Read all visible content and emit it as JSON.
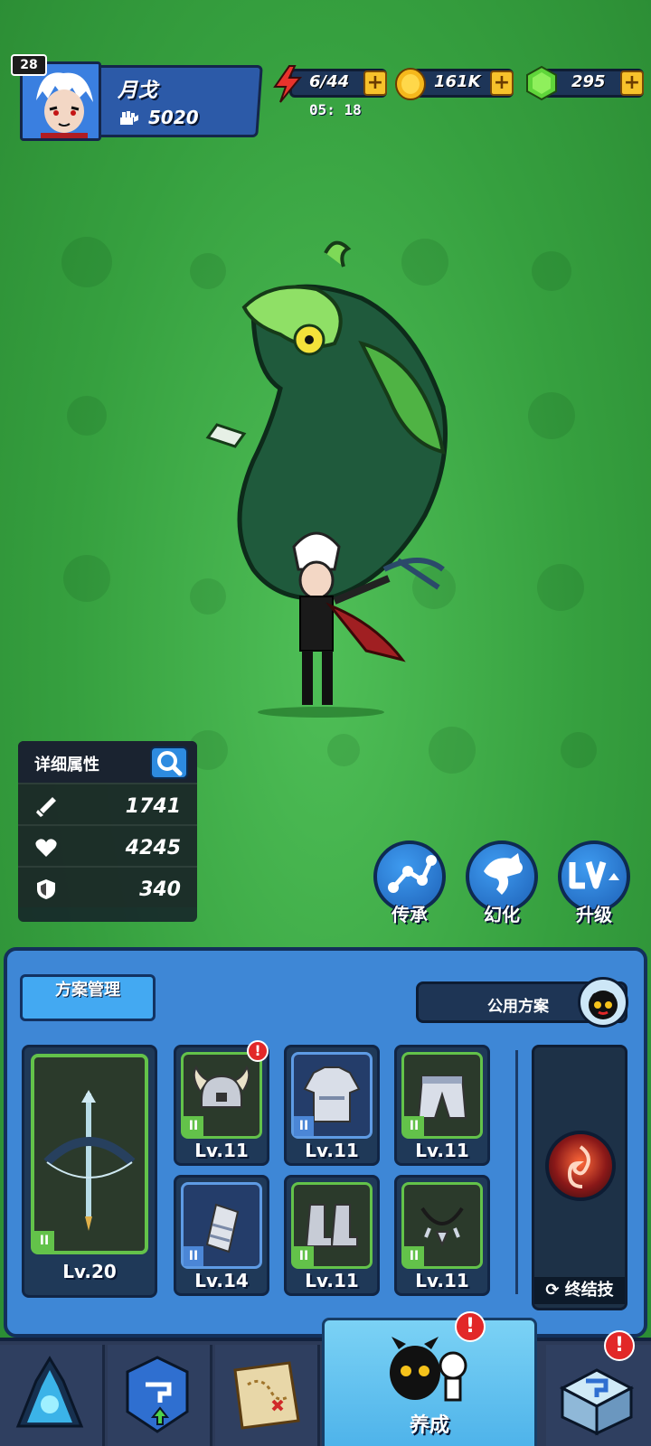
{
  "player": {
    "level": "28",
    "name": "月戈",
    "power": "5020"
  },
  "resources": {
    "energy": "6/44",
    "energy_timer": "05: 18",
    "gold": "161K",
    "gems": "295",
    "plus": "+"
  },
  "stats": {
    "title": "详细属性",
    "attack": "1741",
    "hp": "4245",
    "defense": "340"
  },
  "actions": {
    "inherit": "传承",
    "transform": "幻化",
    "upgrade": "升级"
  },
  "equipment": {
    "scheme_manage": "方案管理",
    "public_scheme": "公用方案",
    "weapon": {
      "tier": "II",
      "level": "Lv.20"
    },
    "slots": [
      {
        "tier": "II",
        "level": "Lv.11",
        "icon": "helmet-icon",
        "alert": "!"
      },
      {
        "tier": "II",
        "level": "Lv.11",
        "icon": "armor-icon"
      },
      {
        "tier": "II",
        "level": "Lv.11",
        "icon": "pants-icon"
      },
      {
        "tier": "II",
        "level": "Lv.14",
        "icon": "bracer-icon"
      },
      {
        "tier": "II",
        "level": "Lv.11",
        "icon": "boots-icon"
      },
      {
        "tier": "II",
        "level": "Lv.11",
        "icon": "necklace-icon"
      }
    ],
    "ultimate": "终结技"
  },
  "nav": {
    "active_label": "养成",
    "alert": "!"
  }
}
